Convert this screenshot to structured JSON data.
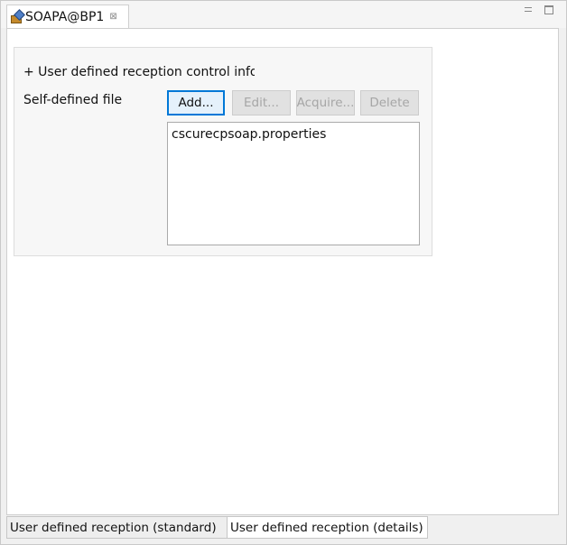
{
  "editor_tab": {
    "title": "SOAPA@BP1",
    "close_glyph": "⊠",
    "icon": "bp-editor-icon"
  },
  "view_controls": {
    "minimize": "minimize-icon",
    "maximize": "maximize-icon"
  },
  "section": {
    "title": "+ User defined reception control info"
  },
  "self_defined_file": {
    "label": "Self-defined file",
    "buttons": {
      "add": "Add...",
      "edit": "Edit...",
      "acquire": "Acquire...",
      "delete": "Delete"
    },
    "files": [
      "cscurecpsoap.properties"
    ]
  },
  "bottom_tabs": [
    {
      "label": "User defined reception (standard)",
      "active": false
    },
    {
      "label": "User defined reception (details)",
      "active": true
    }
  ],
  "colors": {
    "accent": "#0078d7",
    "disabled_text": "#a6a6a6"
  }
}
